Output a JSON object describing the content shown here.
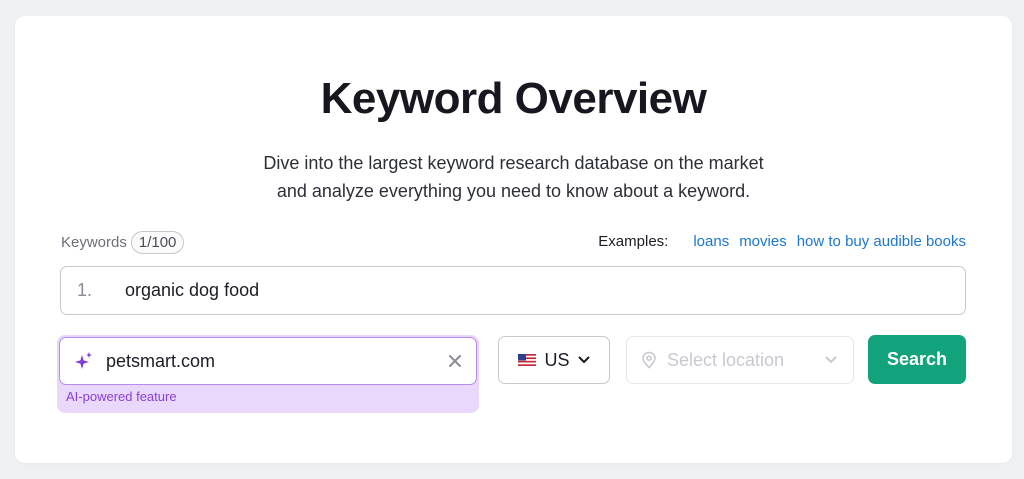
{
  "header": {
    "title": "Keyword Overview",
    "subtitle_line1": "Dive into the largest keyword research database on the market",
    "subtitle_line2": "and analyze everything you need to know about a keyword."
  },
  "keywords": {
    "label": "Keywords",
    "count": "1/100",
    "index": "1.",
    "value": "organic dog food"
  },
  "examples": {
    "label": "Examples:",
    "links": [
      "loans",
      "movies",
      "how to buy audible books"
    ]
  },
  "domain": {
    "value": "petsmart.com",
    "note": "AI-powered feature",
    "icon": "sparkle-icon"
  },
  "country": {
    "selected": "US",
    "flag": "us-flag-icon"
  },
  "location": {
    "placeholder": "Select location"
  },
  "search_button": {
    "label": "Search"
  },
  "colors": {
    "accent": "#13a37c",
    "link": "#1a76d2",
    "ai_bg": "#ead8fc",
    "ai_text": "#8a3fd6"
  }
}
